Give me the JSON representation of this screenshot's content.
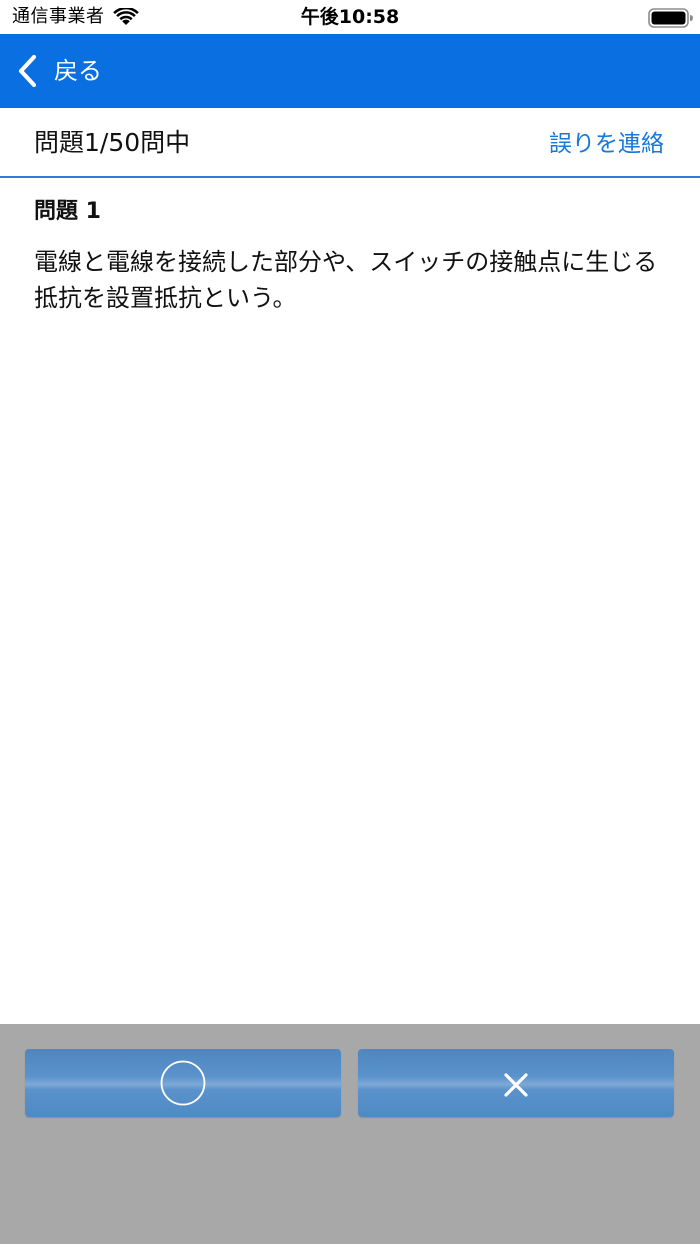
{
  "status_bar": {
    "carrier": "通信事業者",
    "time": "午後10:58",
    "wifi_icon": "wifi-icon",
    "battery_icon": "battery-icon"
  },
  "nav": {
    "back_label": "戻る",
    "back_icon": "chevron-left-icon",
    "background_color": "#0a6fe0"
  },
  "header": {
    "counter": "問題1/50問中",
    "report_link": "誤りを連絡",
    "link_color": "#1878d8"
  },
  "question": {
    "title": "問題 1",
    "text": "電線と電線を接続した部分や、スイッチの接触点に生じる抵抗を設置抵抗という。"
  },
  "answers": {
    "true_icon": "circle-icon",
    "false_icon": "cross-icon",
    "area_color": "#a8a8a8",
    "button_color": "#5a92cb"
  }
}
